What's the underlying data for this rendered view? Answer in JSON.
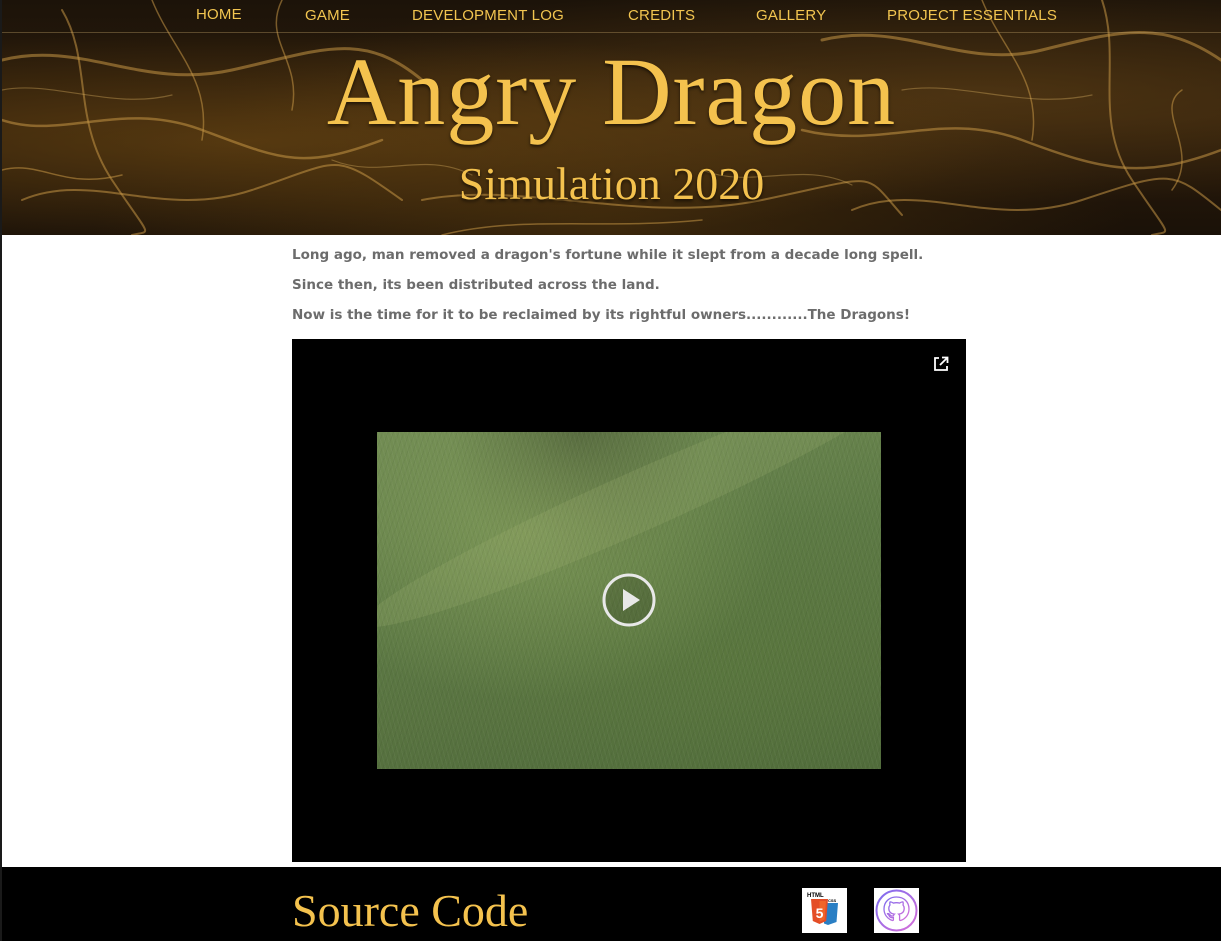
{
  "nav": {
    "items": [
      {
        "label": "HOME"
      },
      {
        "label": "GAME"
      },
      {
        "label": "DEVELOPMENT LOG"
      },
      {
        "label": "CREDITS"
      },
      {
        "label": "GALLERY"
      },
      {
        "label": "PROJECT ESSENTIALS"
      }
    ]
  },
  "header": {
    "title": "Angry Dragon",
    "subtitle": "Simulation 2020"
  },
  "story": {
    "lines": [
      "Long ago, man removed a dragon's fortune while it slept from a decade long spell.",
      "Since then, its been distributed across the land.",
      "Now is the time for it to be reclaimed by its rightful owners............The Dragons!"
    ]
  },
  "video": {
    "external_icon": "open-external-icon",
    "play_icon": "play-icon"
  },
  "footer": {
    "heading": "Source Code",
    "badges": [
      {
        "icon": "html5-css3-icon",
        "html_text": "HTML",
        "css_text": "CSS",
        "digit": "5"
      },
      {
        "icon": "github-icon"
      }
    ]
  },
  "colors": {
    "accent_gold": "#f4c24e",
    "story_text": "#6c6c6c",
    "video_bg": "#000000",
    "footer_bg": "#000000"
  }
}
